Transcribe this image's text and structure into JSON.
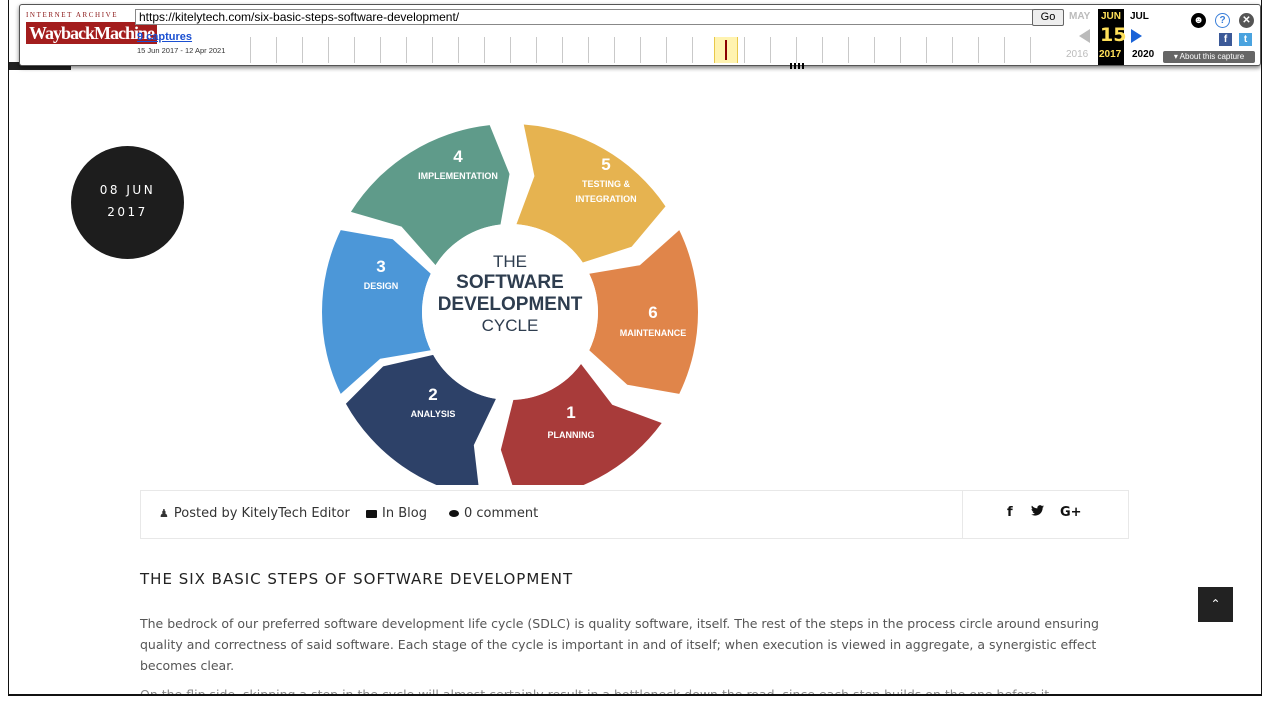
{
  "wayback": {
    "logo_top": "INTERNET ARCHIVE",
    "logo_main": "WaybackMachine",
    "url": "https://kitelytech.com/six-basic-steps-software-development/",
    "go_label": "Go",
    "captures_label": "9 captures",
    "capture_range": "15 Jun 2017 - 12 Apr 2021",
    "prev_month": "MAY",
    "current_month": "JUN",
    "next_month": "JUL",
    "current_day": "15",
    "prev_year": "2016",
    "current_year": "2017",
    "next_year": "2020",
    "about_label": "▾ About this capture"
  },
  "post": {
    "date_line1": "08 JUN",
    "date_line2": "2017",
    "author": "Posted by KitelyTech Editor",
    "category": "In Blog",
    "comments": "0 comment",
    "title": "THE SIX BASIC STEPS OF SOFTWARE DEVELOPMENT",
    "intro": "The bedrock of our preferred software development life cycle (SDLC) is quality software, itself. The rest of the steps in the process circle around ensuring quality and correctness of said software. Each stage of the cycle is important in and of itself; when execution is viewed in aggregate, a synergistic effect becomes clear.",
    "next_para": "On the flip side, skipping a step in the cycle will almost certainly result in a bottleneck down the road, since each step builds on the one before it."
  },
  "social": {
    "facebook": "f",
    "twitter": "🐦",
    "google": "G+"
  },
  "cycle": {
    "center": [
      "THE",
      "SOFTWARE",
      "DEVELOPMENT",
      "CYCLE"
    ],
    "segments": [
      {
        "num": "1",
        "label": "PLANNING",
        "color": "#a83b3a"
      },
      {
        "num": "2",
        "label": "ANALYSIS",
        "color": "#2d4168"
      },
      {
        "num": "3",
        "label": "DESIGN",
        "color": "#4c97d8"
      },
      {
        "num": "4",
        "label": "IMPLEMENTATION",
        "color": "#5f9b8a"
      },
      {
        "num": "5",
        "label": "TESTING &",
        "label2": "INTEGRATION",
        "color": "#e6b350"
      },
      {
        "num": "6",
        "label": "MAINTENANCE",
        "color": "#e0854a"
      }
    ]
  }
}
